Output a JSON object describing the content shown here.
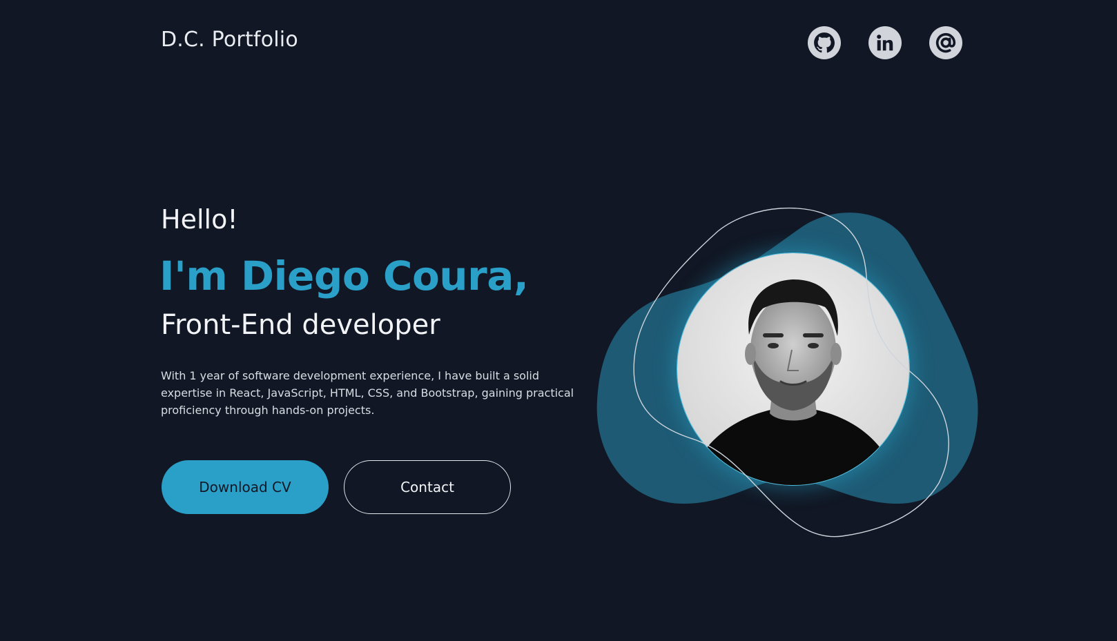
{
  "header": {
    "logo": "D.C. Portfolio",
    "socials": [
      {
        "name": "github",
        "icon": "github-icon"
      },
      {
        "name": "linkedin",
        "icon": "linkedin-icon"
      },
      {
        "name": "email",
        "icon": "at-icon"
      }
    ]
  },
  "hero": {
    "greeting": "Hello!",
    "name": "I'm Diego Coura,",
    "role": "Front-End developer",
    "description": "With 1 year of software development experience, I have built a solid expertise in React, JavaScript, HTML, CSS, and Bootstrap, gaining practical proficiency through hands-on projects.",
    "primary_button": "Download CV",
    "secondary_button": "Contact"
  },
  "colors": {
    "background": "#111724",
    "accent": "#2aa0c9",
    "blob": "#1e5a74",
    "icon_bg": "#d1d5db"
  }
}
